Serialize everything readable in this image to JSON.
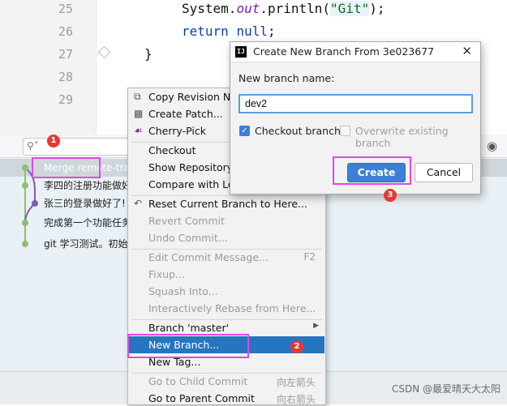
{
  "editor": {
    "line_numbers": [
      "25",
      "26",
      "27",
      "28",
      "29"
    ],
    "code": {
      "l25_a": "System.",
      "l25_b": "out",
      "l25_c": ".println(",
      "l25_d": "\"Git\"",
      "l25_e": ");",
      "l26_kw1": "return",
      "l26_kw2": "null",
      "l26_end": ";",
      "l27": "}"
    }
  },
  "log": {
    "search_placeholder": "",
    "commits": [
      "Merge remote-tra",
      "李四的注册功能做好",
      "张三的登录做好了!",
      "完成第一个功能任务",
      "git 学习测试。初始"
    ]
  },
  "context_menu": {
    "items": [
      {
        "label": "Copy Revision Nu",
        "enabled": true,
        "icon": "copy-icon"
      },
      {
        "label": "Create Patch...",
        "enabled": true,
        "icon": "patch-icon"
      },
      {
        "label": "Cherry-Pick",
        "enabled": true,
        "icon": "cherry-icon"
      },
      {
        "label": "Checkout",
        "enabled": true
      },
      {
        "label": "Show Repository",
        "enabled": true
      },
      {
        "label": "Compare with Loc",
        "enabled": true
      },
      {
        "label": "Reset Current Branch to Here...",
        "enabled": true,
        "icon": "undo-icon"
      },
      {
        "label": "Revert Commit",
        "enabled": false
      },
      {
        "label": "Undo Commit...",
        "enabled": false
      },
      {
        "label": "Edit Commit Message...",
        "enabled": false,
        "shortcut": "F2"
      },
      {
        "label": "Fixup...",
        "enabled": false
      },
      {
        "label": "Squash Into...",
        "enabled": false
      },
      {
        "label": "Interactively Rebase from Here...",
        "enabled": false
      },
      {
        "label": "Branch 'master'",
        "enabled": true,
        "submenu": true
      },
      {
        "label": "New Branch...",
        "enabled": true,
        "selected": true
      },
      {
        "label": "New Tag...",
        "enabled": true
      },
      {
        "label": "Go to Child Commit",
        "enabled": false,
        "shortcut": "向左箭头"
      },
      {
        "label": "Go to Parent Commit",
        "enabled": true,
        "shortcut": "向右箭头"
      }
    ]
  },
  "dialog": {
    "title": "Create New Branch From 3e023677",
    "name_label": "New branch name:",
    "name_value": "dev2",
    "checkout_label": "Checkout branch",
    "checkout_checked": true,
    "overwrite_label": "Overwrite existing branch",
    "overwrite_checked": false,
    "create_label": "Create",
    "cancel_label": "Cancel"
  },
  "annotations": {
    "b1": "1",
    "b2": "2",
    "b3": "3"
  },
  "watermark": "CSDN @最爱晴天大太阳",
  "colors": {
    "selection": "#2675bf",
    "highlight": "#e447e4",
    "badge": "#e53935",
    "accent_button": "#3d7fd6"
  }
}
